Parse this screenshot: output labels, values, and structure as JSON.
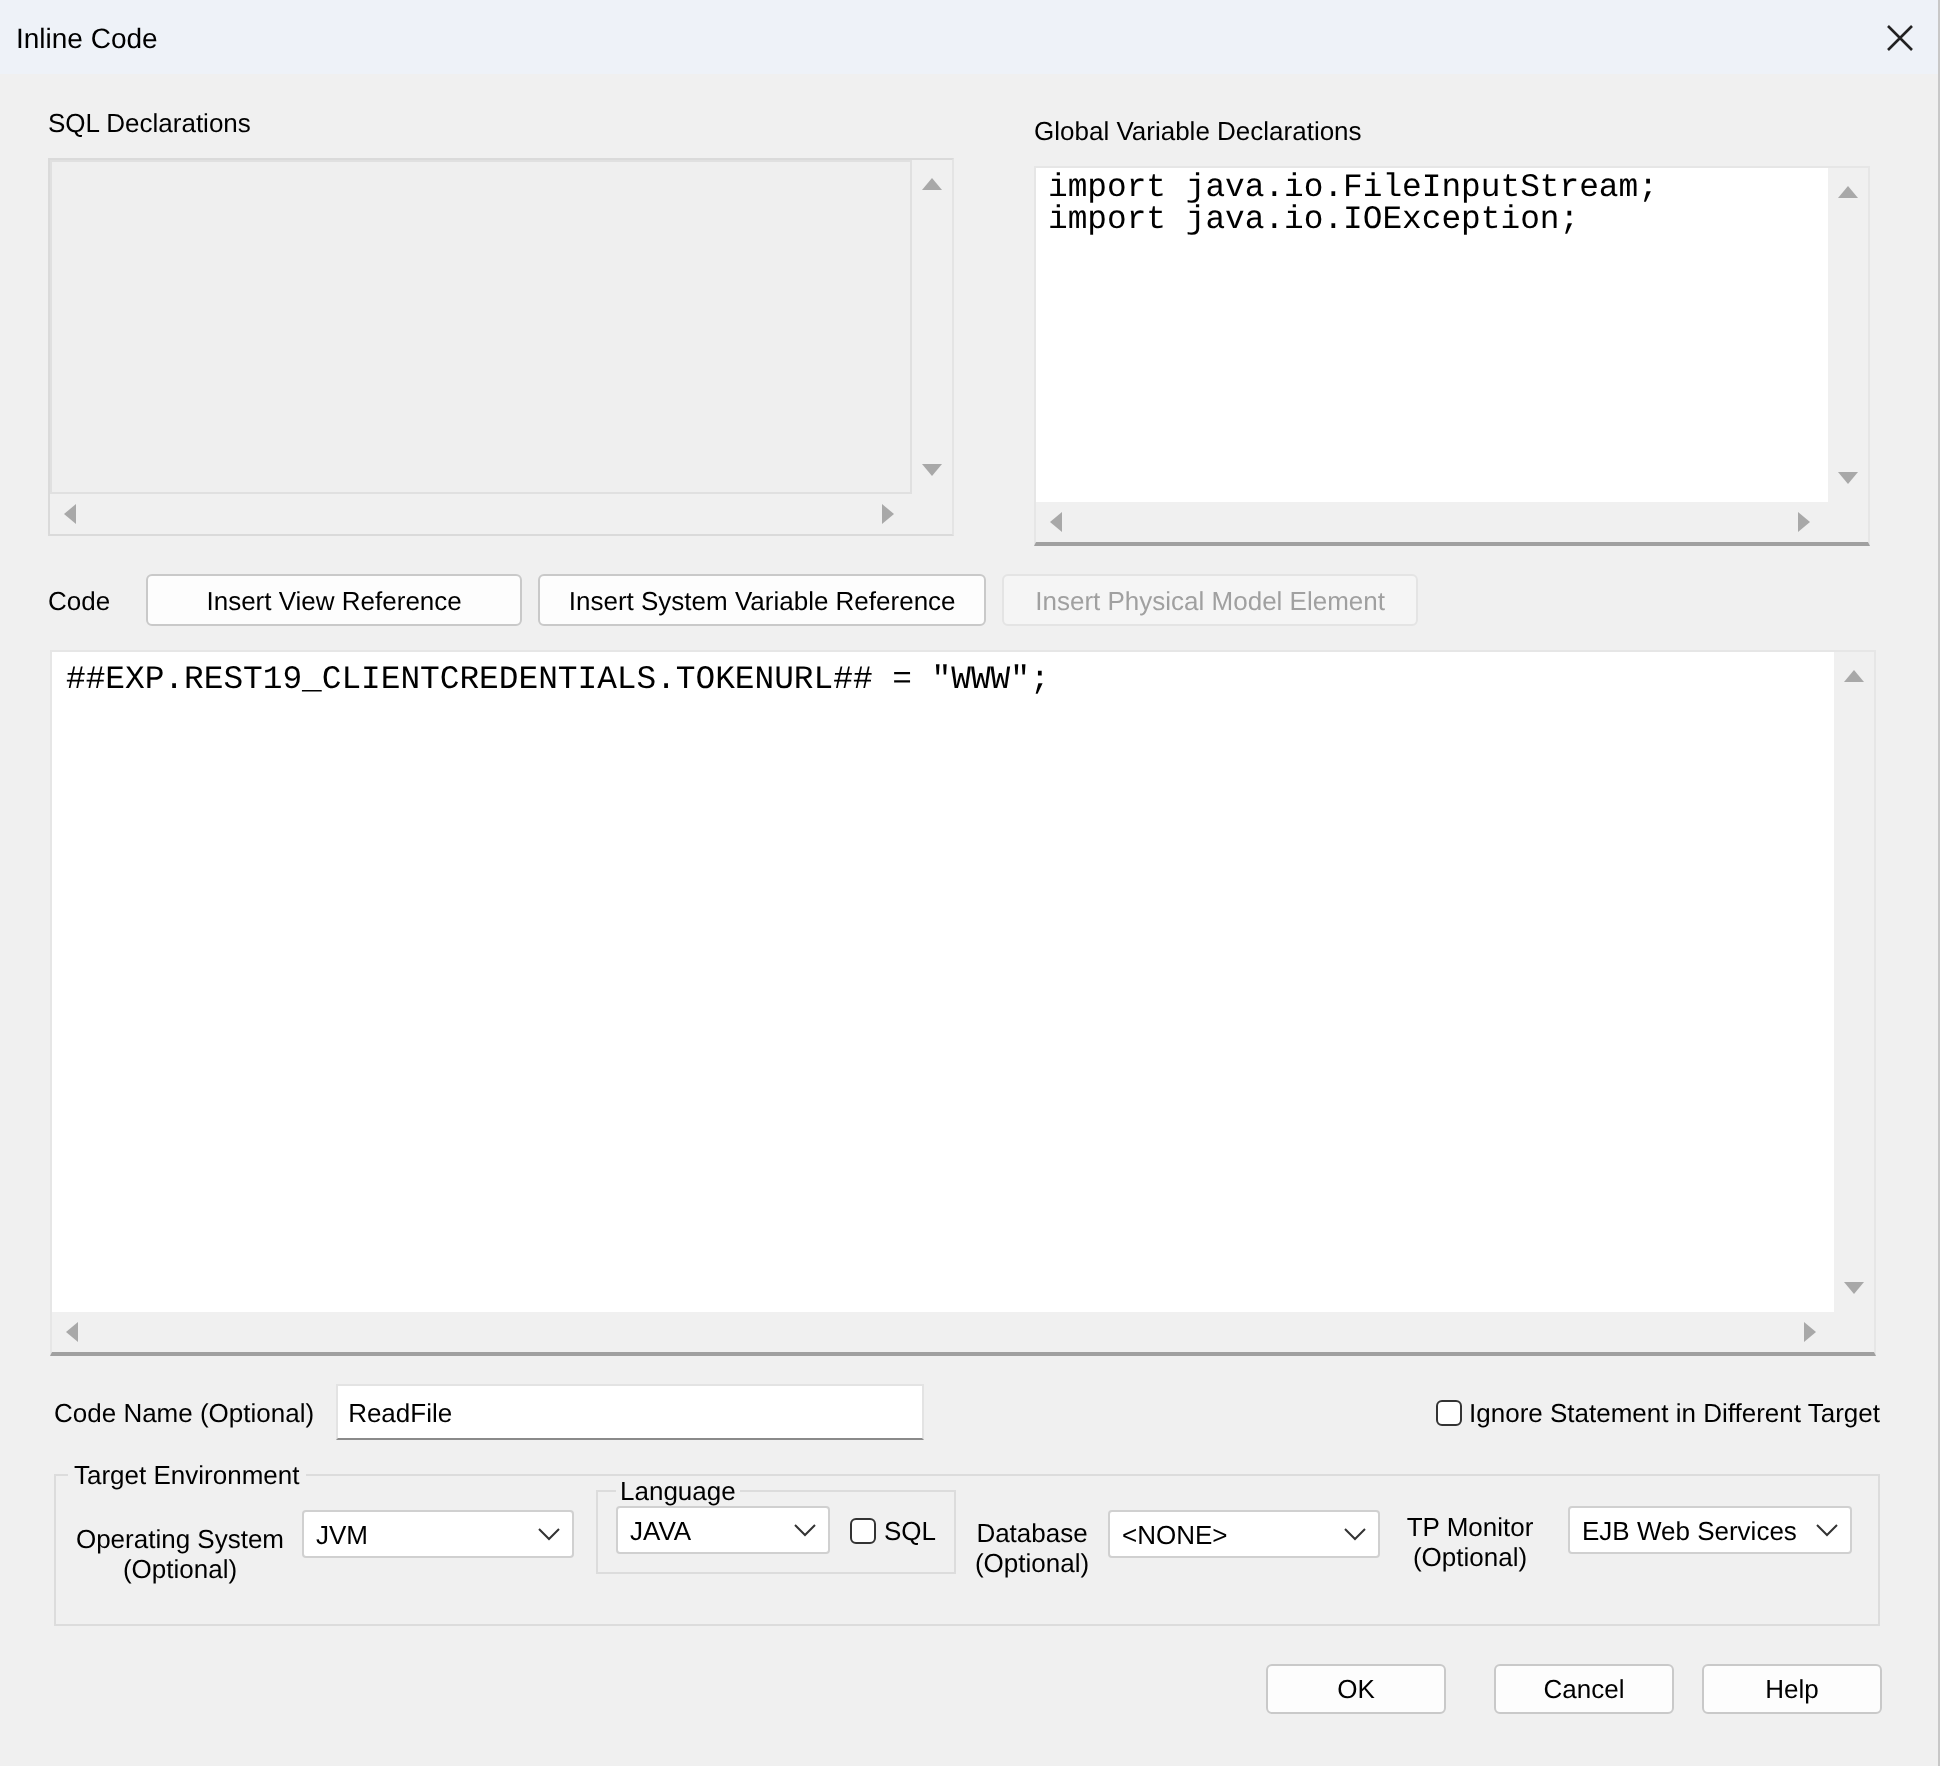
{
  "window": {
    "title": "Inline Code"
  },
  "sql_declarations": {
    "label": "SQL Declarations"
  },
  "global_variable_declarations": {
    "label": "Global Variable Declarations",
    "lines": [
      "import java.io.FileInputStream;",
      "import java.io.IOException;"
    ]
  },
  "code": {
    "label": "Code",
    "buttons": [
      {
        "label": "Insert View Reference",
        "disabled": false
      },
      {
        "label": "Insert System Variable Reference",
        "disabled": false
      },
      {
        "label": "Insert Physical Model Element",
        "disabled": true
      }
    ],
    "lines": [
      "##EXP.REST19_CLIENTCREDENTIALS.TOKENURL## = \"WWW\";"
    ]
  },
  "code_name": {
    "label": "Code Name (Optional)",
    "value": "ReadFile"
  },
  "ignore_statement": {
    "label": "Ignore Statement in Different Target",
    "checked": false
  },
  "target_environment": {
    "title": "Target Environment",
    "operating_system": {
      "label": "Operating System (Optional)",
      "value": "JVM"
    },
    "language": {
      "title": "Language",
      "value": "JAVA",
      "sql": {
        "label": "SQL",
        "checked": false
      }
    },
    "database": {
      "label": "Database (Optional)",
      "value": "<NONE>"
    },
    "tp_monitor": {
      "label": "TP Monitor (Optional)",
      "value": "EJB Web Services"
    }
  },
  "buttons": [
    "OK",
    "Cancel",
    "Help"
  ]
}
